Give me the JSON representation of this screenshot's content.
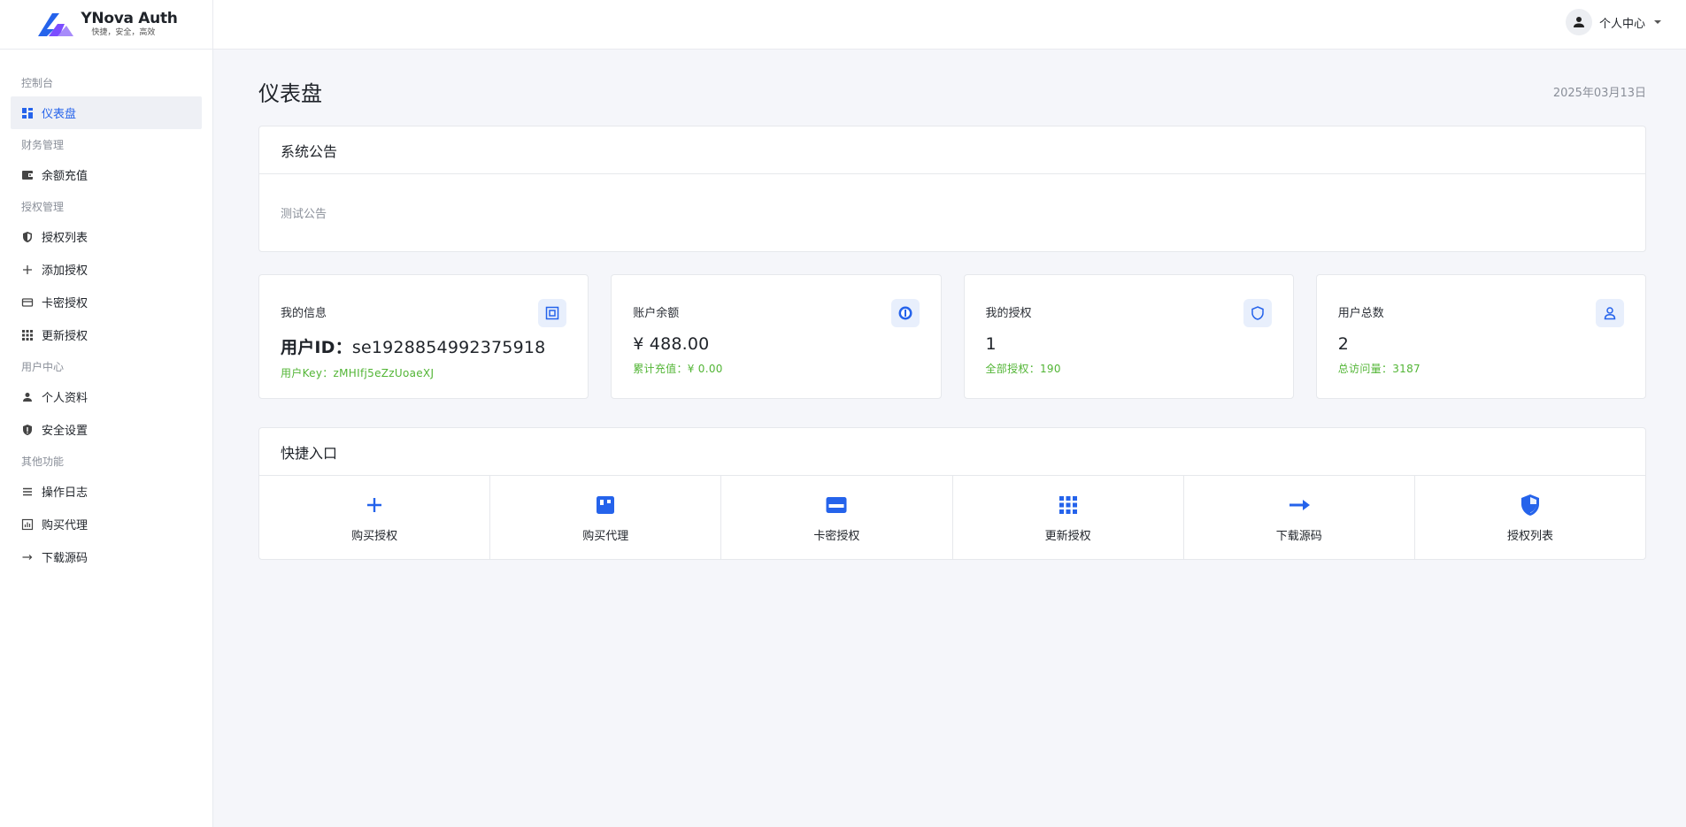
{
  "brand": {
    "title": "YNova Auth",
    "subtitle": "快捷，安全，高效"
  },
  "header": {
    "user_label": "个人中心"
  },
  "sidebar": {
    "sections": [
      {
        "label": "控制台",
        "items": [
          {
            "label": "仪表盘",
            "icon": "dashboard-icon",
            "active": true
          }
        ]
      },
      {
        "label": "财务管理",
        "items": [
          {
            "label": "余额充值",
            "icon": "wallet-icon"
          }
        ]
      },
      {
        "label": "授权管理",
        "items": [
          {
            "label": "授权列表",
            "icon": "shield-icon"
          },
          {
            "label": "添加授权",
            "icon": "plus-icon"
          },
          {
            "label": "卡密授权",
            "icon": "card-icon"
          },
          {
            "label": "更新授权",
            "icon": "grid-icon"
          }
        ]
      },
      {
        "label": "用户中心",
        "items": [
          {
            "label": "个人资料",
            "icon": "person-icon"
          },
          {
            "label": "安全设置",
            "icon": "security-shield-icon"
          }
        ]
      },
      {
        "label": "其他功能",
        "items": [
          {
            "label": "操作日志",
            "icon": "list-icon"
          },
          {
            "label": "购买代理",
            "icon": "chart-icon"
          },
          {
            "label": "下载源码",
            "icon": "arrow-right-icon"
          }
        ]
      }
    ]
  },
  "page": {
    "title": "仪表盘",
    "date": "2025年03月13日"
  },
  "notice": {
    "title": "系统公告",
    "body": "测试公告"
  },
  "stats": [
    {
      "label": "我的信息",
      "value_prefix": "用户ID：",
      "value": "se1928854992375918",
      "sub": "用户Key：zMHIfj5eZzUoaeXJ",
      "icon": "chip-icon"
    },
    {
      "label": "账户余额",
      "value_prefix": "",
      "value": "¥ 488.00",
      "sub": "累计充值：¥ 0.00",
      "icon": "coin-icon"
    },
    {
      "label": "我的授权",
      "value_prefix": "",
      "value": "1",
      "sub": "全部授权：190",
      "icon": "shield-outline-icon"
    },
    {
      "label": "用户总数",
      "value_prefix": "",
      "value": "2",
      "sub": "总访问量：3187",
      "icon": "user-outline-icon"
    }
  ],
  "quick": {
    "title": "快捷入口",
    "items": [
      {
        "label": "购买授权",
        "icon": "plus-icon"
      },
      {
        "label": "购买代理",
        "icon": "board-icon"
      },
      {
        "label": "卡密授权",
        "icon": "card-icon"
      },
      {
        "label": "更新授权",
        "icon": "grid-icon"
      },
      {
        "label": "下载源码",
        "icon": "arrow-right-icon"
      },
      {
        "label": "授权列表",
        "icon": "shield-icon"
      }
    ]
  },
  "colors": {
    "accent": "#2563eb",
    "success": "#52b535",
    "background": "#f5f6fa"
  }
}
